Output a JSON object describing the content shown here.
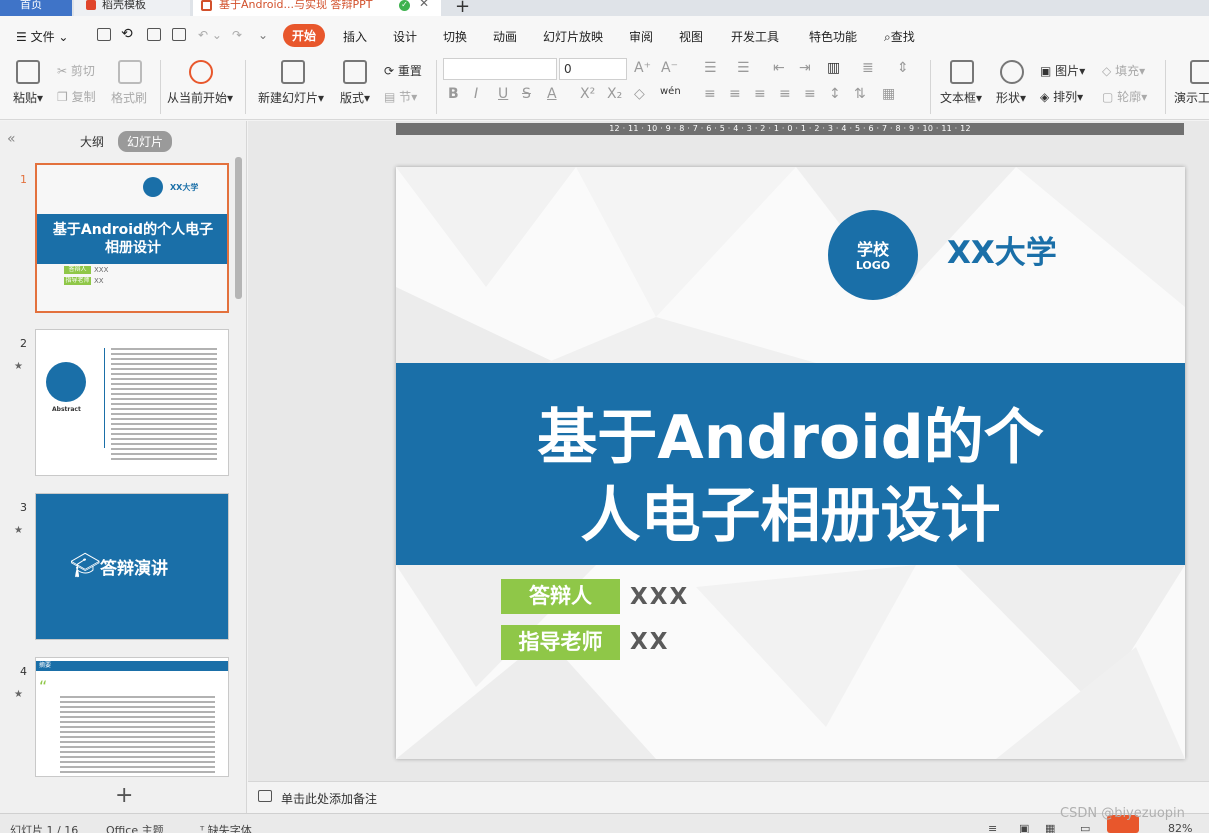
{
  "tabs": {
    "home": "首页",
    "templates": "稻壳模板",
    "document": "基于Android...与实现 答辩PPT"
  },
  "menu": {
    "file": "文件",
    "items": [
      "开始",
      "插入",
      "设计",
      "切换",
      "动画",
      "幻灯片放映",
      "审阅",
      "视图",
      "开发工具",
      "特色功能"
    ],
    "search": "查找"
  },
  "ribbon": {
    "paste": "粘贴",
    "cut": "剪切",
    "copy": "复制",
    "format_painter": "格式刷",
    "play_from_current": "从当前开始",
    "new_slide": "新建幻灯片",
    "layout": "版式",
    "reset": "重置",
    "section": "节",
    "font_size": "0",
    "text_box": "文本框",
    "shape": "形状",
    "picture": "图片",
    "arrange": "排列",
    "fill": "填充",
    "outline": "轮廓",
    "presentation_tool": "演示工"
  },
  "left_panel": {
    "outline_tab": "大纲",
    "slides_tab": "幻灯片",
    "thumbnails": [
      {
        "num": "1",
        "title": "基于Android的个人电子相册设计",
        "school": "XX大学",
        "label1": "答辩人",
        "val1": "XXX",
        "label2": "指导老师",
        "val2": "XX"
      },
      {
        "num": "2",
        "caption": "Abstract"
      },
      {
        "num": "3",
        "title": "答辩演讲"
      },
      {
        "num": "4",
        "header": "摘要"
      }
    ]
  },
  "ruler": "12 · 11 · 10 · 9 · 8 · 7 · 6 · 5 · 4 · 3 · 2 · 1 · 0 · 1 · 2 · 3 · 4 · 5 · 6 · 7 · 8 · 9 · 10 · 11 · 12",
  "slide": {
    "logo_line1": "学校",
    "logo_line2": "LOGO",
    "university": "XX大学",
    "title_line1": "基于Android的个",
    "title_line2": "人电子相册设计",
    "defender_label": "答辩人",
    "defender_value": "XXX",
    "advisor_label": "指导老师",
    "advisor_value": "XX"
  },
  "notes": {
    "placeholder": "单击此处添加备注"
  },
  "status": {
    "slide_count": "幻灯片 1 / 16",
    "theme": "Office 主题",
    "missing_font": "缺失字体",
    "zoom": "82%"
  },
  "watermark": "CSDN @biyezuopin",
  "colors": {
    "accent": "#1a6fa8",
    "green_label": "#8fc748",
    "active_tab": "#e8572c"
  }
}
